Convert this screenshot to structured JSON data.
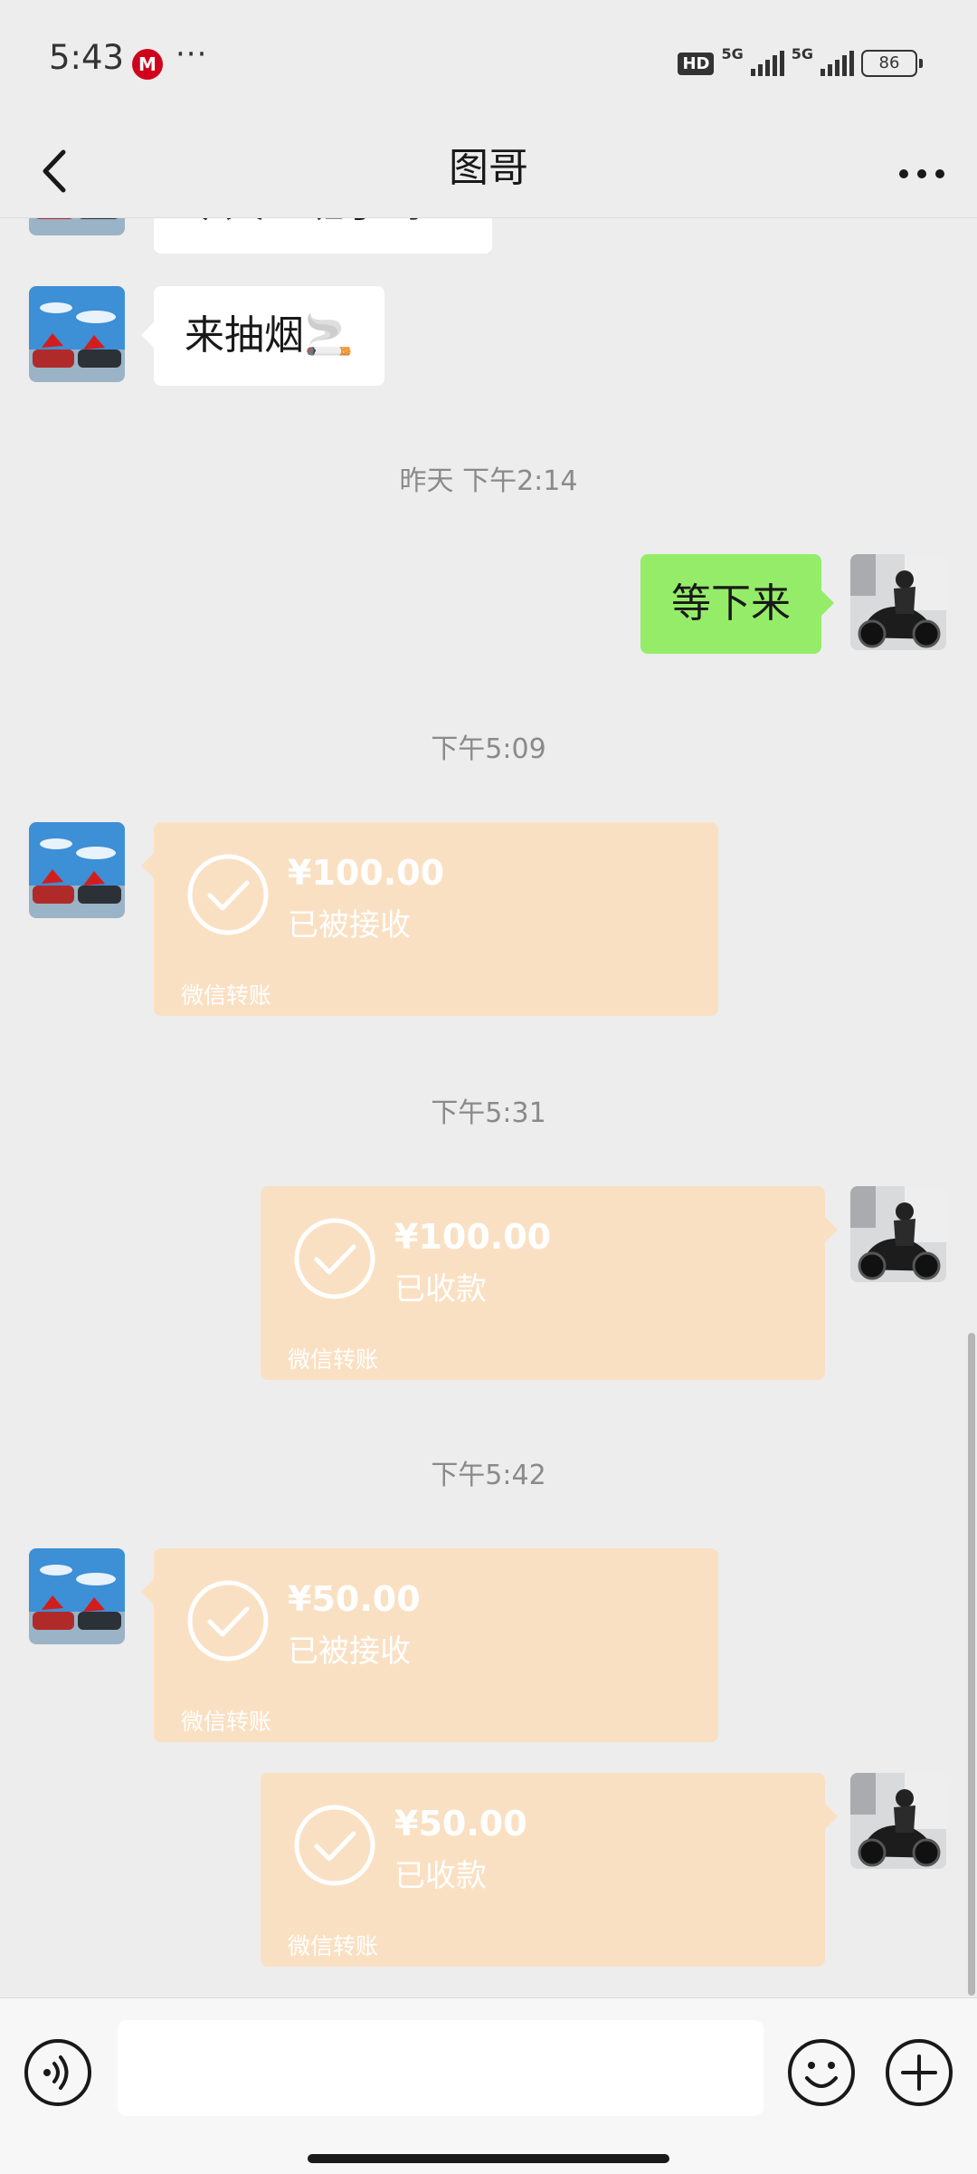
{
  "status_bar": {
    "time": "5:43",
    "bank_app_glyph": "M",
    "more": "···",
    "hd": "HD",
    "net1": "5G",
    "net2": "5G",
    "battery": "86"
  },
  "header": {
    "title": "图哥",
    "back_icon": "chevron-left-icon",
    "more_icon": "ellipsis-icon"
  },
  "messages": {
    "partial_text": "今天上班了吗",
    "text_smoke": "来抽烟🚬",
    "time_1": "昨天 下午2:14",
    "text_wait": "等下来",
    "time_2": "下午5:09",
    "transfer_1": {
      "amount": "¥100.00",
      "status": "已被接收",
      "label": "微信转账"
    },
    "time_3": "下午5:31",
    "transfer_2": {
      "amount": "¥100.00",
      "status": "已收款",
      "label": "微信转账"
    },
    "time_4": "下午5:42",
    "transfer_3": {
      "amount": "¥50.00",
      "status": "已被接收",
      "label": "微信转账"
    },
    "transfer_4": {
      "amount": "¥50.00",
      "status": "已收款",
      "label": "微信转账"
    }
  },
  "input_bar": {
    "placeholder": "",
    "voice_icon": "voice-icon",
    "emoji_icon": "emoji-icon",
    "plus_icon": "plus-icon"
  },
  "colors": {
    "background": "#ededed",
    "sent_bubble": "#95ec69",
    "received_bubble": "#ffffff",
    "transfer_card": "#fae0c2"
  }
}
